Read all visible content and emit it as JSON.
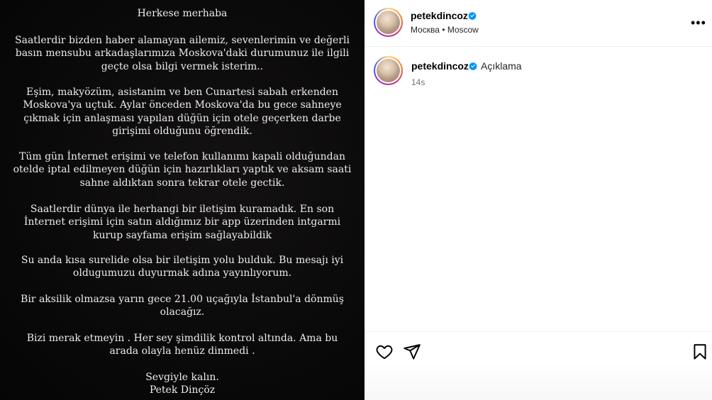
{
  "post": {
    "lines": [
      "Herkese merhaba",
      "Saatlerdir bizden haber alamayan ailemiz, sevenlerimin ve değerli",
      "basın mensubu arkadaşlarımıza Moskova'daki durumunuz ile ilgili",
      "geçte olsa bilgi vermek isterim..",
      "Eşim, makyözüm, asistanim ve ben Cunartesi sabah erkenden",
      "Moskova'ya uçtuk. Aylar önceden Moskova'da bu gece sahneye",
      "çıkmak için anlaşması yapılan düğün için otele geçerken darbe",
      "girişimi olduğunu öğrendik.",
      "Tüm gün İnternet erişimi ve telefon kullanımı kapali olduğundan",
      "otelde iptal edilmeyen düğün için hazırlıkları yaptık ve aksam saati",
      "sahne aldıktan sonra tekrar otele gectik.",
      "Saatlerdir dünya ile herhangi bir iletişim kuramadık. En son",
      "İnternet erişimi için satın aldığımız bir app üzerinden intgarmi",
      "kurup sayfama erişim sağlayabildik",
      "Su anda kısa surelide olsa bir iletişim yolu bulduk.  Bu mesajı iyi",
      "oldugumuzu duyurmak adına yayınlıyorum.",
      "Bir aksilik olmazsa yarın gece 21.00 uçağıyla İstanbul'a dönmüş",
      "olacağız.",
      "Bizi merak etmeyin . Her sey şimdilik kontrol altında. Ama bu",
      "arada olayla henüz dinmedi .",
      "Sevgiyle kalın.",
      "Petek Dinçöz"
    ]
  },
  "header": {
    "username": "petekdincoz",
    "location": "Москва • Moscow",
    "more_label": "•••"
  },
  "caption": {
    "username": "petekdincoz",
    "text": "Açıklama",
    "time": "14s"
  },
  "icons": {
    "verified": "verified-badge-icon",
    "like": "heart-icon",
    "share": "send-icon",
    "save": "bookmark-icon"
  },
  "colors": {
    "verified_blue": "#0095f6",
    "post_background": "#0b0a0a",
    "post_text": "#ececec",
    "secondary_text": "#737373"
  }
}
